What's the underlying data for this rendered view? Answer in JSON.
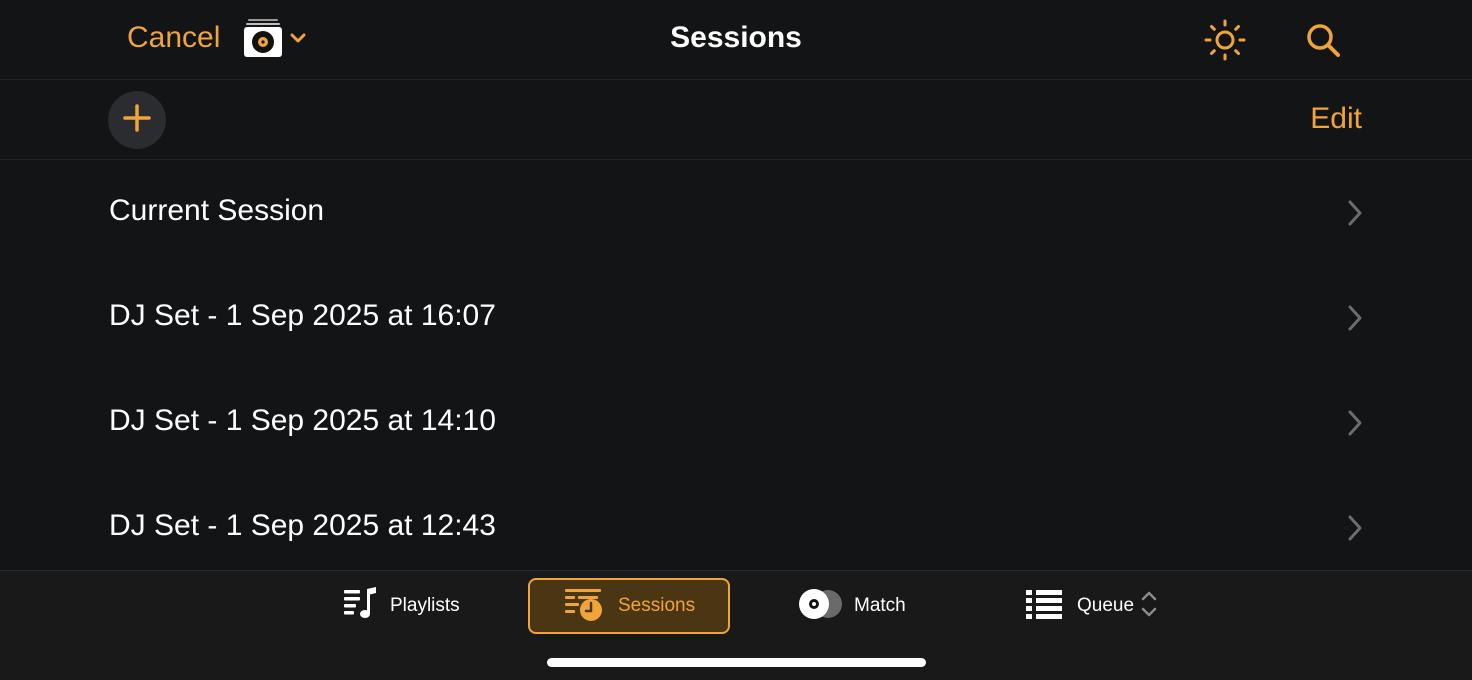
{
  "navbar": {
    "cancel_label": "Cancel",
    "title": "Sessions",
    "source_icon": "turntable-record-icon",
    "brightness_icon": "sun-icon",
    "search_icon": "magnifier-icon"
  },
  "toolbar": {
    "add_icon": "plus-icon",
    "edit_label": "Edit"
  },
  "sessions": [
    {
      "label": "Current Session"
    },
    {
      "label": "DJ Set - 1 Sep 2025 at 16:07"
    },
    {
      "label": "DJ Set - 1 Sep 2025 at 14:10"
    },
    {
      "label": "DJ Set - 1 Sep 2025 at 12:43"
    }
  ],
  "tabbar": {
    "tabs": [
      {
        "label": "Playlists",
        "icon": "playlist-icon",
        "selected": false
      },
      {
        "label": "Sessions",
        "icon": "sessions-clock-icon",
        "selected": true
      },
      {
        "label": "Match",
        "icon": "record-match-icon",
        "selected": false
      },
      {
        "label": "Queue",
        "icon": "list-icon",
        "selected": false
      }
    ]
  },
  "colors": {
    "accent": "#f0a43a",
    "background": "#131416",
    "tabbar": "#19191a",
    "selected_tab_bg": "#4b3614",
    "chevron": "#6b6c70"
  }
}
